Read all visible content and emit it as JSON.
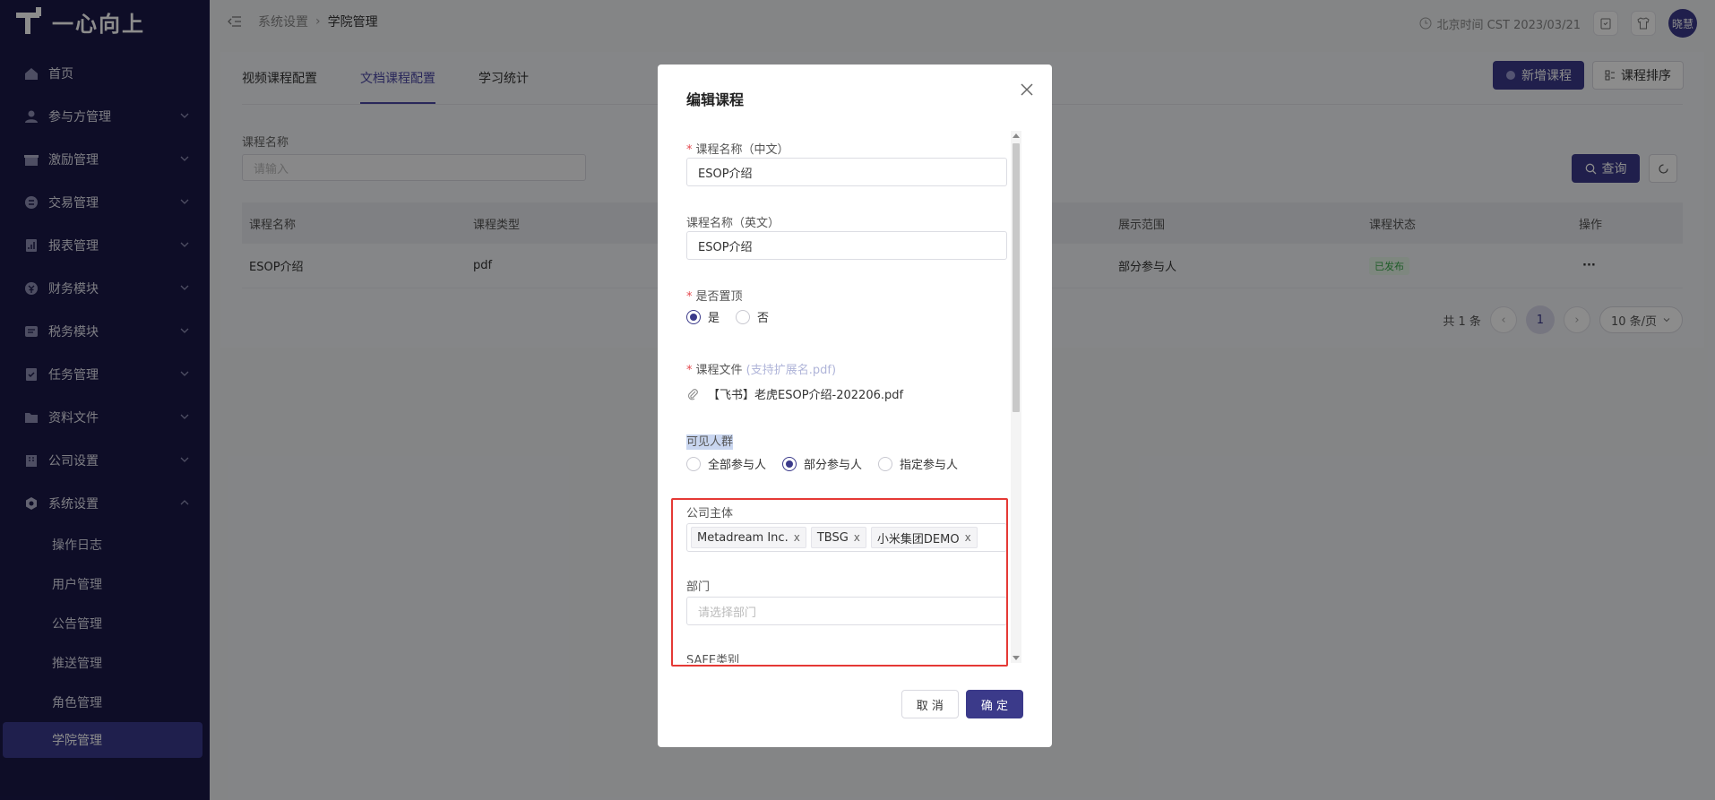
{
  "app": {
    "logo_text": "一心向上"
  },
  "sidebar": {
    "items": [
      {
        "label": "首页",
        "icon": "home-icon"
      },
      {
        "label": "参与方管理",
        "icon": "people-icon"
      },
      {
        "label": "激励管理",
        "icon": "gift-icon"
      },
      {
        "label": "交易管理",
        "icon": "exchange-icon"
      },
      {
        "label": "报表管理",
        "icon": "report-icon"
      },
      {
        "label": "财务模块",
        "icon": "finance-icon"
      },
      {
        "label": "税务模块",
        "icon": "tax-icon"
      },
      {
        "label": "任务管理",
        "icon": "task-icon"
      },
      {
        "label": "资料文件",
        "icon": "folder-icon"
      },
      {
        "label": "公司设置",
        "icon": "company-icon"
      },
      {
        "label": "系统设置",
        "icon": "settings-icon"
      }
    ],
    "sub_items": [
      {
        "label": "操作日志"
      },
      {
        "label": "用户管理"
      },
      {
        "label": "公告管理"
      },
      {
        "label": "推送管理"
      },
      {
        "label": "角色管理"
      },
      {
        "label": "学院管理"
      }
    ]
  },
  "header": {
    "breadcrumb": [
      "系统设置",
      "学院管理"
    ],
    "clock_text": "北京时间 CST 2023/03/21",
    "avatar_text": "晓慧"
  },
  "main": {
    "tabs": [
      "视频课程配置",
      "文档课程配置",
      "学习统计"
    ],
    "add_course": "新增课程",
    "sort_course": "课程排序",
    "filter_label": "课程名称",
    "filter_placeholder": "请输入",
    "query": "查询",
    "columns": [
      "课程名称",
      "课程类型",
      "展示范围",
      "课程状态",
      "操作"
    ],
    "rows": [
      {
        "name": "ESOP介绍",
        "type": "pdf",
        "scope": "部分参与人",
        "status": "已发布",
        "op": "···"
      }
    ],
    "pager": {
      "total": "共 1 条",
      "page": "1",
      "size": "10 条/页"
    }
  },
  "modal": {
    "title": "编辑课程",
    "name_cn_label": "课程名称（中文）",
    "name_cn_value": "ESOP介绍",
    "name_en_label": "课程名称（英文）",
    "name_en_value": "ESOP介绍",
    "pin_label": "是否置顶",
    "pin_yes": "是",
    "pin_no": "否",
    "file_label": "课程文件",
    "file_hint": "(支持扩展名.pdf)",
    "file_name": "【飞书】老虎ESOP介绍-202206.pdf",
    "visible_label": "可见人群",
    "visible_all": "全部参与人",
    "visible_part": "部分参与人",
    "visible_spec": "指定参与人",
    "company_label": "公司主体",
    "company_tags": [
      "Metadream Inc.",
      "TBSG",
      "小米集团DEMO"
    ],
    "tag_close": "x",
    "dept_label": "部门",
    "dept_placeholder": "请选择部门",
    "safe_label": "SAFE类别",
    "cancel": "取 消",
    "ok": "确 定"
  },
  "colors": {
    "sidebar_bg": "#1a1848",
    "primary": "#3b3a8a",
    "highlight_box": "#e53935"
  }
}
